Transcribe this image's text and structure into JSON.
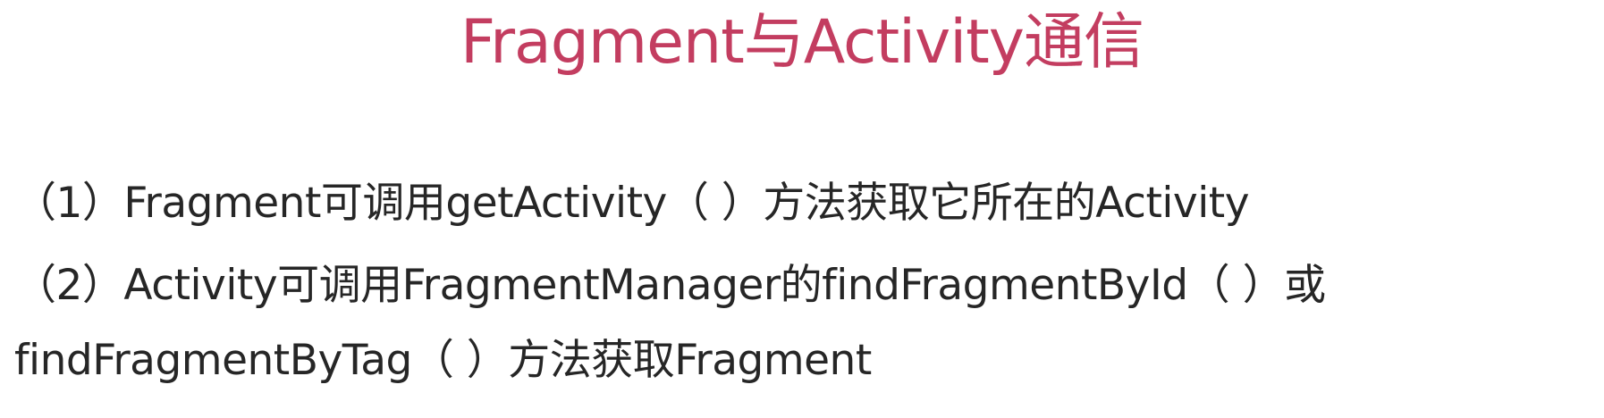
{
  "slide": {
    "title": "Fragment与Activity通信",
    "lines": [
      "（1）Fragment可调用getActivity（ ）方法获取它所在的Activity",
      "（2）Activity可调用FragmentManager的findFragmentById（ ）或",
      "findFragmentByTag（ ）方法获取Fragment"
    ]
  },
  "colors": {
    "title": "#c33d60",
    "body_text": "#262626",
    "background": "#ffffff"
  }
}
